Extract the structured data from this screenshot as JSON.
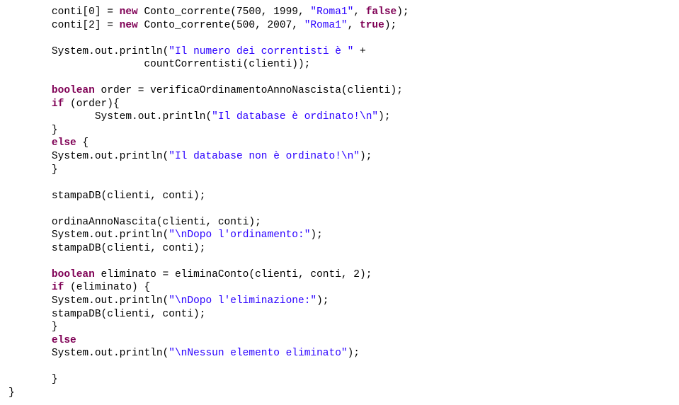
{
  "code": {
    "l1_a": "conti[0] = ",
    "l1_kw": "new",
    "l1_b": " Conto_corrente(7500, 1999, ",
    "l1_str": "\"Roma1\"",
    "l1_c": ", ",
    "l1_kw2": "false",
    "l1_d": ");",
    "l2_a": "conti[2] = ",
    "l2_kw": "new",
    "l2_b": " Conto_corrente(500, 2007, ",
    "l2_str": "\"Roma1\"",
    "l2_c": ", ",
    "l2_kw2": "true",
    "l2_d": ");",
    "l3": "",
    "l4_a": "System.",
    "l4_f": "out",
    "l4_b": ".println(",
    "l4_str": "\"Il numero dei correntisti è \"",
    "l4_c": " +",
    "l5_a": "                      countCorrentisti(clienti));",
    "l6": "",
    "l7_kw": "boolean",
    "l7_a": " order = verificaOrdinamentoAnnoNascista(clienti);",
    "l8_kw": "if",
    "l8_a": " (order){",
    "l9_a": "              System.",
    "l9_f": "out",
    "l9_b": ".println(",
    "l9_str": "\"Il database è ordinato!\\n\"",
    "l9_c": ");",
    "l10_a": "}",
    "l11_kw": "else",
    "l11_a": " {",
    "l12_a": "       System.",
    "l12_f": "out",
    "l12_b": ".println(",
    "l12_str": "\"Il database non è ordinato!\\n\"",
    "l12_c": ");",
    "l13_a": "}",
    "l14": "",
    "l15_a": "stampaDB(clienti, conti);",
    "l16": "",
    "l17_a": "ordinaAnnoNascita(clienti, conti);",
    "l18_a": "System.",
    "l18_f": "out",
    "l18_b": ".println(",
    "l18_str": "\"\\nDopo l'ordinamento:\"",
    "l18_c": ");",
    "l19_a": "stampaDB(clienti, conti);",
    "l20": "",
    "l21_kw": "boolean",
    "l21_a": " eliminato = eliminaConto(clienti, conti, 2);",
    "l22_kw": "if",
    "l22_a": " (eliminato) {",
    "l23_a": "       System.",
    "l23_f": "out",
    "l23_b": ".println(",
    "l23_str": "\"\\nDopo l'eliminazione:\"",
    "l23_c": ");",
    "l24_a": "       stampaDB(clienti, conti);",
    "l25_a": "}",
    "l26_kw": "else",
    "l27_a": "       System.",
    "l27_f": "out",
    "l27_b": ".println(",
    "l27_str": "\"\\nNessun elemento eliminato\"",
    "l27_c": ");",
    "l28": "",
    "l29_a": "       }",
    "l30_a": "}"
  }
}
